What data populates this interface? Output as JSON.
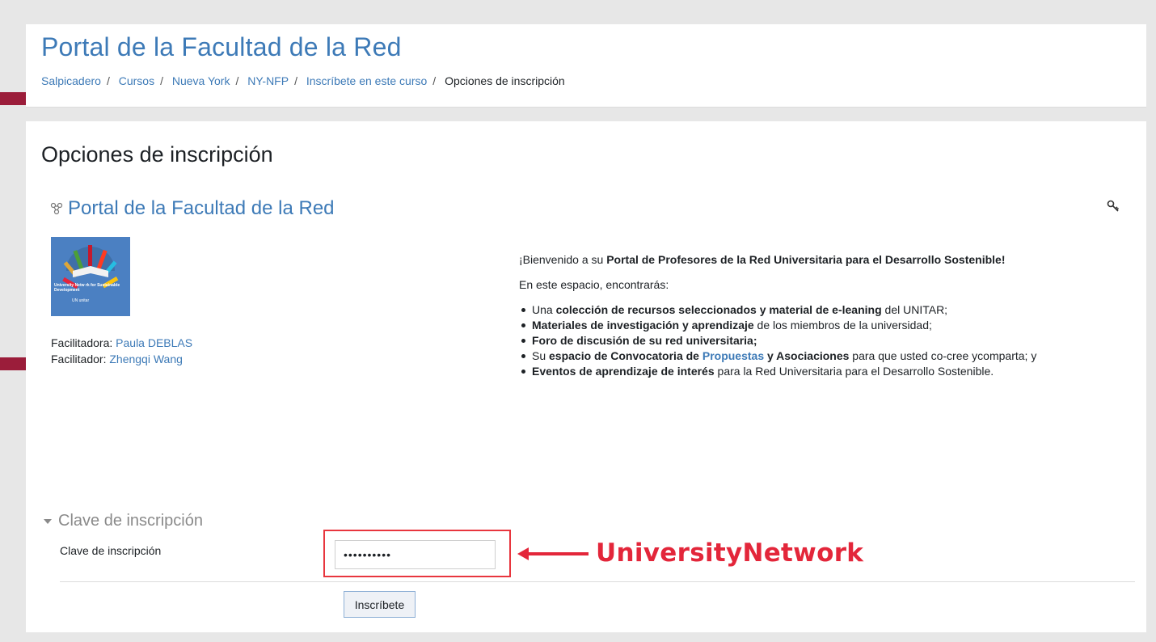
{
  "header": {
    "site_title": "Portal de la Facultad de la Red",
    "breadcrumb": [
      "Salpicadero",
      "Cursos",
      "Nueva York",
      "NY-NFP",
      "Inscríbete en este curso"
    ],
    "breadcrumb_current": "Opciones de inscripción",
    "separator": "/"
  },
  "main": {
    "heading": "Opciones de inscripción",
    "course_title": "Portal de la Facultad de la Red",
    "image_caption": "University Netw  rk for Sustainable Development",
    "image_logos": "UN  unitar",
    "contacts": [
      {
        "role": "Facilitadora:",
        "name": "Paula DEBLAS"
      },
      {
        "role": "Facilitador:",
        "name": "Zhengqi Wang"
      }
    ],
    "summary": {
      "welcome_prefix": "¡Bienvenido a su ",
      "welcome_bold": "Portal de Profesores de la Red Universitaria para el Desarrollo Sostenible!",
      "intro": "En este espacio, encontrarás:",
      "items": [
        {
          "a": "Una ",
          "b": "colección de recursos seleccionados y material de e-leaning",
          "c": " del UNITAR;"
        },
        {
          "a": "",
          "b": "Materiales de investigación y aprendizaje",
          "c": " de los miembros de la universidad;"
        },
        {
          "a": "",
          "b": "Foro de discusión de su red universitaria;",
          "c": ""
        },
        {
          "a": "Su ",
          "b": "espacio de Convocatoria de ",
          "link": "Propuestas",
          "b2": " y Asociaciones",
          "c": " para que usted co-cree ycomparta; y"
        },
        {
          "a": "",
          "b": "Eventos de aprendizaje de interés",
          "c": " para la Red Universitaria para el Desarrollo Sostenible."
        }
      ]
    }
  },
  "enrol": {
    "section_title": "Clave de inscripción",
    "field_label": "Clave de inscripción",
    "field_value": "••••••••••",
    "submit_label": "Inscríbete",
    "annotation": "UniversityNetwork"
  },
  "colors": {
    "link": "#3d7ab7",
    "annotation_red": "#e3263a",
    "side_mark": "#9b1d3a"
  }
}
